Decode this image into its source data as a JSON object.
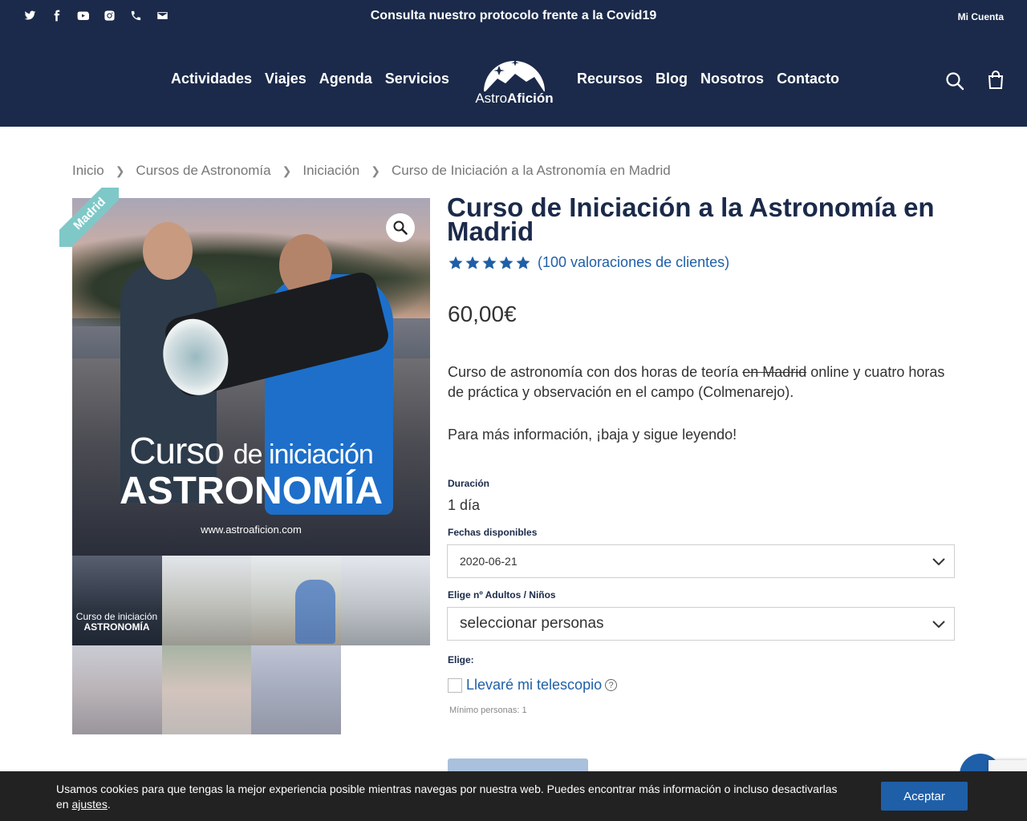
{
  "header": {
    "socials": [
      "twitter-icon",
      "facebook-icon",
      "youtube-icon",
      "instagram-icon",
      "phone-icon",
      "email-icon"
    ],
    "promo": "Consulta nuestro protocolo frente a la Covid19",
    "account": "Mi Cuenta",
    "nav_left": [
      "Actividades",
      "Viajes",
      "Agenda",
      "Servicios"
    ],
    "nav_right": [
      "Recursos",
      "Blog",
      "Nosotros",
      "Contacto"
    ],
    "logo": {
      "text_light": "Astro",
      "text_bold": "Afición"
    },
    "colors": {
      "header_bg": "#1b2a4a",
      "accent": "#1f5fa8"
    }
  },
  "breadcrumb": [
    "Inicio",
    "Cursos de Astronomía",
    "Iniciación",
    "Curso de Iniciación a la Astronomía en Madrid"
  ],
  "gallery": {
    "ribbon": "Madrid",
    "overlay_line1_a": "Curso",
    "overlay_line1_b": "de iniciación",
    "overlay_line2": "ASTRONOMÍA",
    "overlay_url": "www.astroaficion.com",
    "thumb1_line1": "Curso de iniciación",
    "thumb1_line2": "ASTRONOMÍA"
  },
  "product": {
    "title": "Curso de Iniciación a la Astronomía en Madrid",
    "rating": 5,
    "reviews": "(100 valoraciones de clientes)",
    "price": "60,00€",
    "desc_a": "Curso de astronomía con dos horas de teoría ",
    "desc_strike": "en Madrid",
    "desc_b": " online y cuatro horas de práctica y observación en el campo (Colmenarejo).",
    "desc2": "Para más información, ¡baja y sigue leyendo!",
    "duration_label": "Duración",
    "duration_value": "1 día",
    "dates_label": "Fechas disponibles",
    "dates_value": "2020-06-21",
    "people_label": "Elige nº Adultos / Niños",
    "people_value": "seleccionar personas",
    "choose_label": "Elige:",
    "telescope_label": "Llevaré mi telescopio",
    "help": "?",
    "min_people": "Mínimo personas: 1"
  },
  "cookie": {
    "text": "Usamos cookies para que tengas la mejor experiencia posible mientras navegas por nuestra web. Puedes encontrar más información o incluso desactivarlas en ",
    "link": "ajustes",
    "end": ".",
    "accept": "Aceptar"
  }
}
